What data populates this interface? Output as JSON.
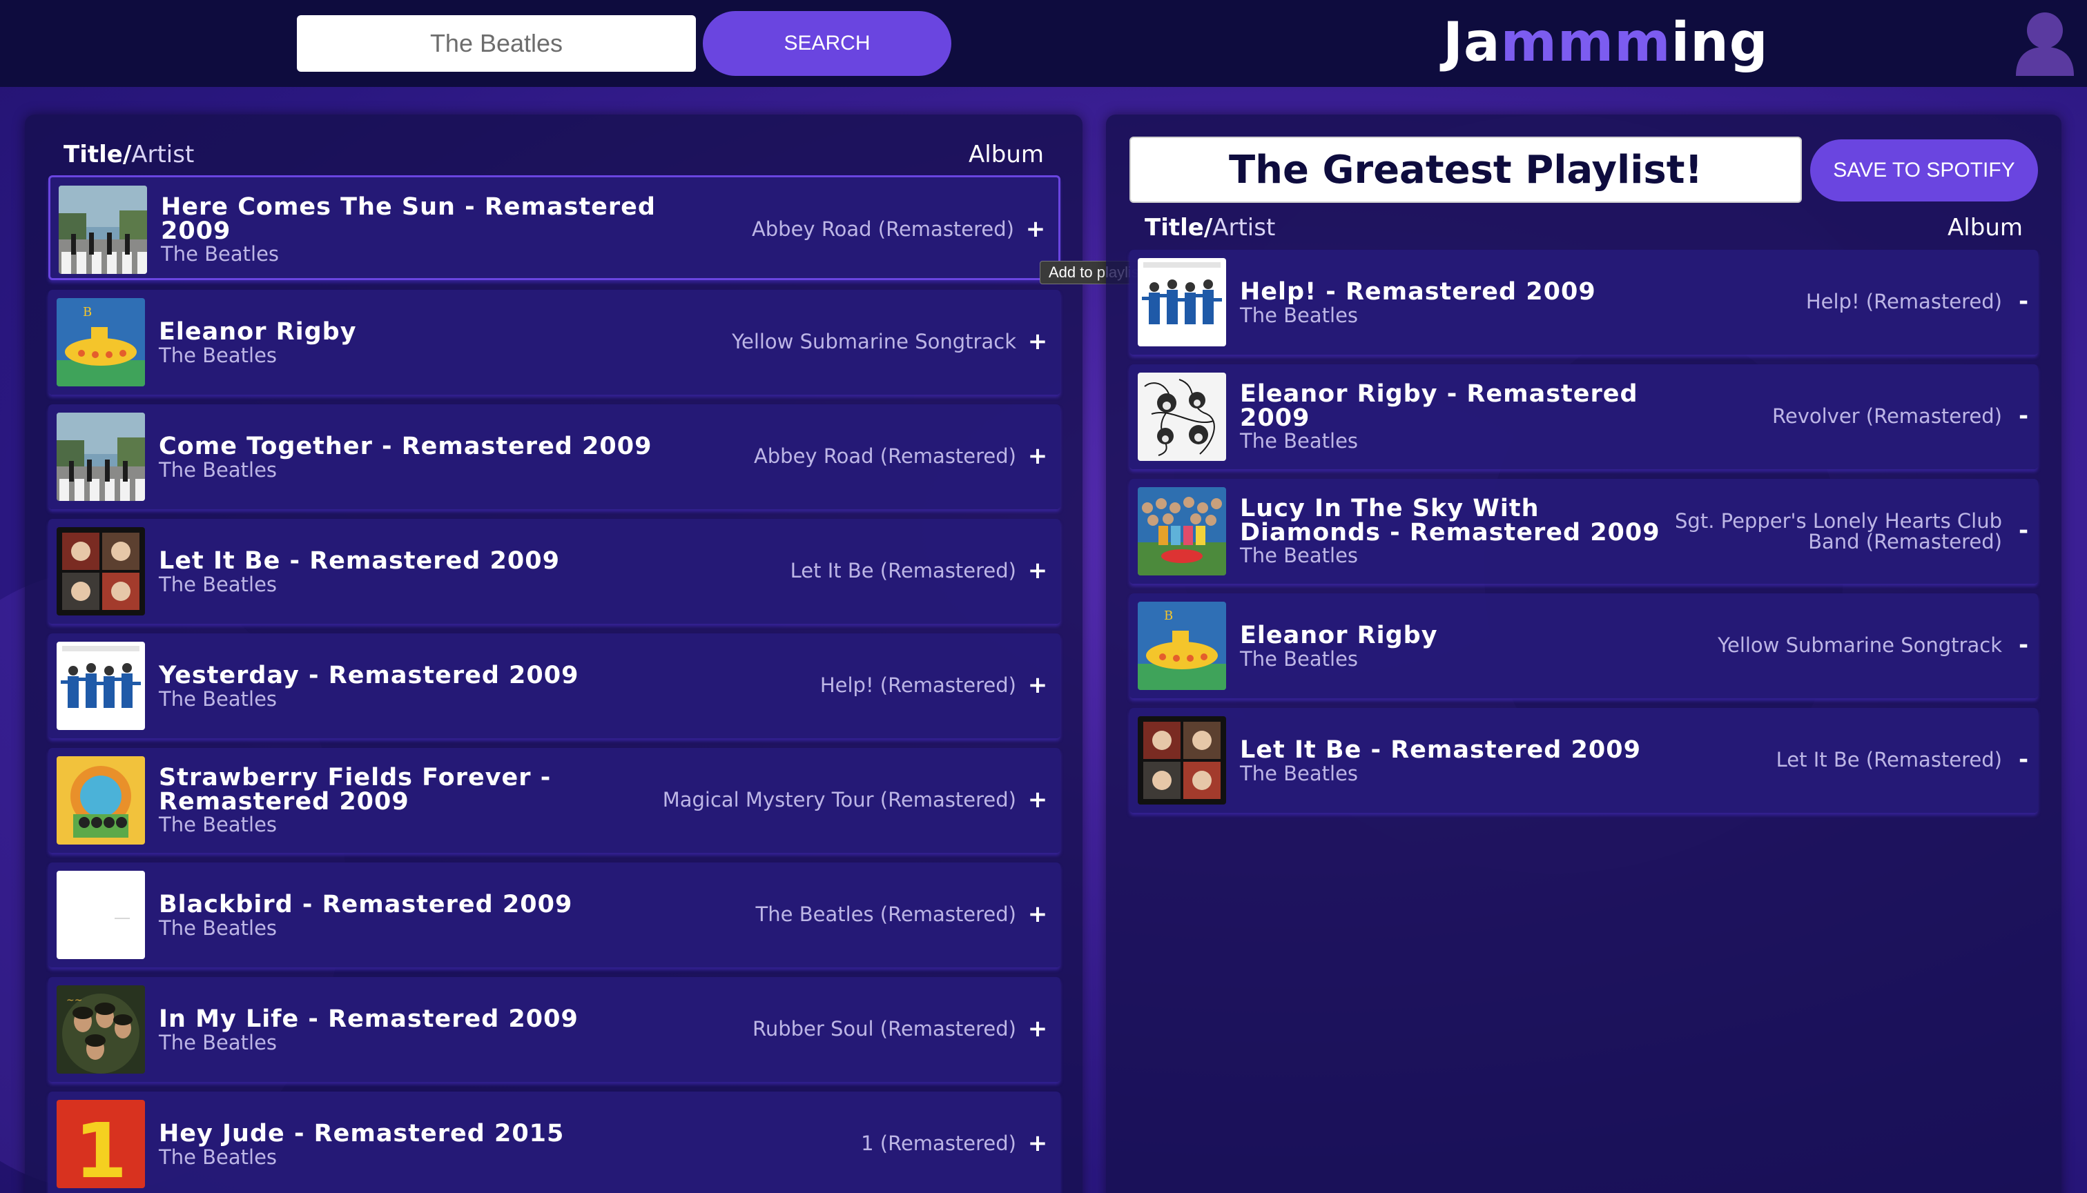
{
  "header": {
    "search_value": "The Beatles",
    "search_button": "SEARCH",
    "logo_parts": [
      "Ja",
      "mmm",
      "ing"
    ]
  },
  "results": {
    "col_title_bold": "Title/",
    "col_title_rest": "Artist",
    "col_album": "Album",
    "action": "+",
    "tooltip": "Add to playlist",
    "tracks": [
      {
        "title_l1": "Here Comes The Sun - Remastered",
        "title_l2": "2009",
        "artist": "The Beatles",
        "album": "Abbey Road (Remastered)",
        "cover": "abbey-road"
      },
      {
        "title_l1": "Eleanor Rigby",
        "title_l2": "",
        "artist": "The Beatles",
        "album": "Yellow Submarine Songtrack",
        "cover": "yellow-submarine"
      },
      {
        "title_l1": "Come Together - Remastered 2009",
        "title_l2": "",
        "artist": "The Beatles",
        "album": "Abbey Road (Remastered)",
        "cover": "abbey-road"
      },
      {
        "title_l1": "Let It Be - Remastered 2009",
        "title_l2": "",
        "artist": "The Beatles",
        "album": "Let It Be (Remastered)",
        "cover": "let-it-be"
      },
      {
        "title_l1": "Yesterday - Remastered 2009",
        "title_l2": "",
        "artist": "The Beatles",
        "album": "Help! (Remastered)",
        "cover": "help"
      },
      {
        "title_l1": "Strawberry Fields Forever -",
        "title_l2": "Remastered 2009",
        "artist": "The Beatles",
        "album": "Magical Mystery Tour (Remastered)",
        "cover": "magical-mystery-tour"
      },
      {
        "title_l1": "Blackbird - Remastered 2009",
        "title_l2": "",
        "artist": "The Beatles",
        "album": "The Beatles (Remastered)",
        "cover": "white-album"
      },
      {
        "title_l1": "In My Life - Remastered 2009",
        "title_l2": "",
        "artist": "The Beatles",
        "album": "Rubber Soul (Remastered)",
        "cover": "rubber-soul"
      },
      {
        "title_l1": "Hey Jude - Remastered 2015",
        "title_l2": "",
        "artist": "The Beatles",
        "album": "1 (Remastered)",
        "cover": "one"
      }
    ]
  },
  "playlist": {
    "name": "The Greatest Playlist!",
    "save_button": "SAVE TO SPOTIFY",
    "col_title_bold": "Title/",
    "col_title_rest": "Artist",
    "col_album": "Album",
    "action": "-",
    "tracks": [
      {
        "title_l1": "Help! - Remastered 2009",
        "title_l2": "",
        "artist": "The Beatles",
        "album_l1": "Help! (Remastered)",
        "album_l2": "",
        "cover": "help"
      },
      {
        "title_l1": "Eleanor Rigby - Remastered",
        "title_l2": "2009",
        "artist": "The Beatles",
        "album_l1": "Revolver (Remastered)",
        "album_l2": "",
        "cover": "revolver"
      },
      {
        "title_l1": "Lucy In The Sky With",
        "title_l2": "Diamonds - Remastered 2009",
        "artist": "The Beatles",
        "album_l1": "Sgt. Pepper's Lonely Hearts Club",
        "album_l2": "Band (Remastered)",
        "cover": "sgt-pepper"
      },
      {
        "title_l1": "Eleanor Rigby",
        "title_l2": "",
        "artist": "The Beatles",
        "album_l1": "Yellow Submarine Songtrack",
        "album_l2": "",
        "cover": "yellow-submarine"
      },
      {
        "title_l1": "Let It Be - Remastered 2009",
        "title_l2": "",
        "artist": "The Beatles",
        "album_l1": "Let It Be (Remastered)",
        "album_l2": "",
        "cover": "let-it-be"
      }
    ]
  },
  "cover_art": {
    "one_text": "1"
  }
}
